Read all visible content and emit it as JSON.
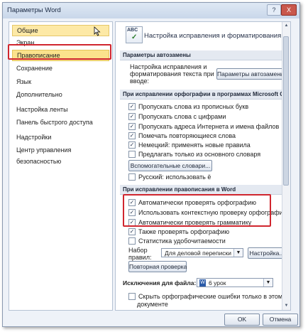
{
  "window": {
    "title": "Параметры Word",
    "help_label": "?",
    "close_label": "X"
  },
  "sidebar": {
    "items": [
      {
        "label": "Общие"
      },
      {
        "label": "Экран"
      },
      {
        "label": "Правописание"
      },
      {
        "label": "Сохранение"
      },
      {
        "label": "Язык"
      },
      {
        "label": "Дополнительно"
      },
      {
        "label": "Настройка ленты"
      },
      {
        "label": "Панель быстрого доступа"
      },
      {
        "label": "Надстройки"
      },
      {
        "label": "Центр управления безопасностью"
      }
    ]
  },
  "main": {
    "heading": "Настройка исправления и форматирования текста.",
    "icon_text": "ABC",
    "autocorrect": {
      "section": "Параметры автозамены",
      "text1": "Настройка исправления и",
      "text2": "форматирования текста при",
      "text3": "вводе:",
      "button": "Параметры автозамены..."
    },
    "office": {
      "section": "При исправлении орфографии в программах Microsoft Office",
      "items": [
        {
          "label": "Пропускать слова из прописных букв",
          "checked": "✓"
        },
        {
          "label": "Пропускать слова с цифрами",
          "checked": "✓"
        },
        {
          "label": "Пропускать адреса Интернета и имена файлов",
          "checked": "✓"
        },
        {
          "label": "Помечать повторяющиеся слова",
          "checked": "✓"
        },
        {
          "label": "Немецкий: применять новые правила",
          "checked": "✓"
        },
        {
          "label": "Предлагать только из основного словаря",
          "checked": ""
        }
      ],
      "dict_button": "Вспомогательные словари...",
      "russian": {
        "label": "Русский: использовать ё",
        "checked": ""
      }
    },
    "word": {
      "section": "При исправлении правописания в Word",
      "items": [
        {
          "label": "Автоматически проверять орфографию",
          "checked": "✓"
        },
        {
          "label": "Использовать контекстную проверку орфографии",
          "checked": "✓"
        },
        {
          "label": "Автоматически проверять грамматику",
          "checked": "✓"
        },
        {
          "label": "Также проверять орфографию",
          "checked": "✓"
        },
        {
          "label": "Статистика удобочитаемости",
          "checked": ""
        }
      ],
      "rules_label1": "Набор",
      "rules_label2": "правил:",
      "rules_value": "Для деловой переписки",
      "settings_button": "Настройка...",
      "recheck_button": "Повторная проверка"
    },
    "exceptions": {
      "label": "Исключения для файла:",
      "value": "6 урок",
      "option_label": "Скрыть орфографические ошибки только в этом",
      "option_label2": "документе",
      "checked": ""
    }
  },
  "footer": {
    "ok": "OK",
    "cancel": "Отмена"
  }
}
